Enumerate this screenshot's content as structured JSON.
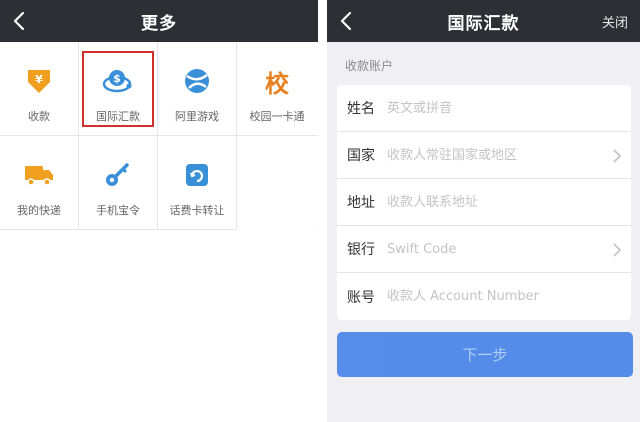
{
  "left_screen": {
    "title": "更多",
    "icons": [
      {
        "label": "收款",
        "icon": "yuan-shield-icon"
      },
      {
        "label": "国际汇款",
        "icon": "dollar-globe-icon"
      },
      {
        "label": "阿里游戏",
        "icon": "game-ball-icon"
      },
      {
        "label": "校园一卡通",
        "icon_text": "校"
      },
      {
        "label": "我的快递",
        "icon": "delivery-truck-icon"
      },
      {
        "label": "手机宝令",
        "icon": "key-icon"
      },
      {
        "label": "话费卡转让",
        "icon": "phone-card-icon"
      }
    ]
  },
  "right_screen": {
    "title": "国际汇款",
    "close_label": "关闭",
    "section_label": "收款账户",
    "fields": [
      {
        "label": "姓名",
        "placeholder": "英文或拼音"
      },
      {
        "label": "国家",
        "placeholder": "收款人常驻国家或地区"
      },
      {
        "label": "地址",
        "placeholder": "收款人联系地址"
      },
      {
        "label": "银行",
        "placeholder": "Swift Code"
      },
      {
        "label": "账号",
        "placeholder": "收款人 Account Number"
      }
    ],
    "next_label": "下一步"
  },
  "colors": {
    "navbar": "#2d2f35",
    "highlight": "#d0312a",
    "button": "#3b7be8",
    "icon_blue": "#3a8fd9",
    "icon_orange": "#f0a01e"
  }
}
